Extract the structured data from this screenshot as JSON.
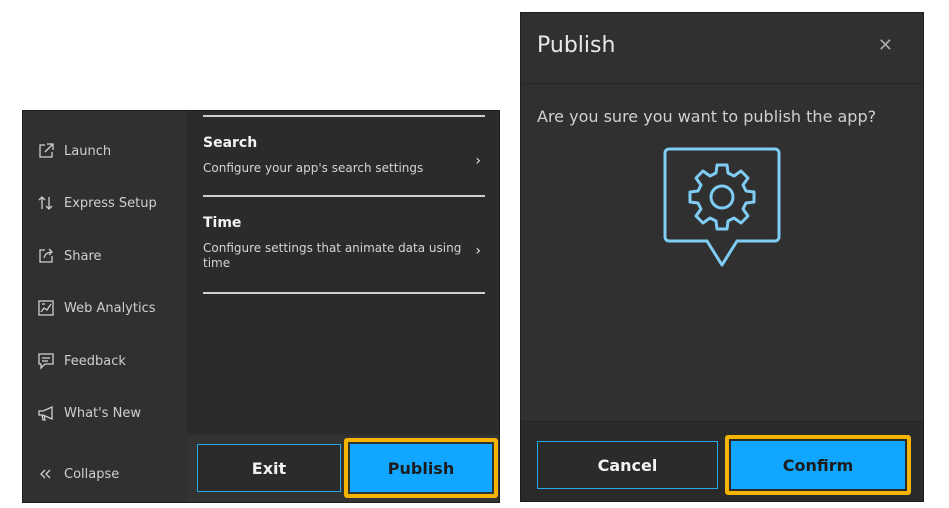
{
  "left_panel": {
    "sidebar": {
      "items": [
        {
          "label": "Launch",
          "icon": "launch-icon"
        },
        {
          "label": "Express Setup",
          "icon": "sort-arrows-icon"
        },
        {
          "label": "Share",
          "icon": "share-icon"
        },
        {
          "label": "Web Analytics",
          "icon": "analytics-icon"
        },
        {
          "label": "Feedback",
          "icon": "feedback-icon"
        },
        {
          "label": "What's New",
          "icon": "megaphone-icon"
        }
      ],
      "collapse": {
        "label": "Collapse",
        "icon": "double-chevron-left-icon"
      }
    },
    "settings": [
      {
        "title": "Search",
        "description": "Configure your app's search settings",
        "icon": "chevron-right-icon"
      },
      {
        "title": "Time",
        "description": "Configure settings that animate data using time",
        "icon": "chevron-right-icon"
      }
    ],
    "footer": {
      "exit_label": "Exit",
      "publish_label": "Publish"
    }
  },
  "dialog": {
    "title": "Publish",
    "close_icon": "close-icon",
    "message": "Are you sure you want to publish the app?",
    "illustration_icon": "gear-speech-bubble-icon",
    "cancel_label": "Cancel",
    "confirm_label": "Confirm"
  },
  "colors": {
    "accent": "#11a6ff",
    "outline": "#2aa7e8",
    "highlight": "#f5b400",
    "panel": "#2b2b2b",
    "illustration": "#7fcdf5"
  }
}
